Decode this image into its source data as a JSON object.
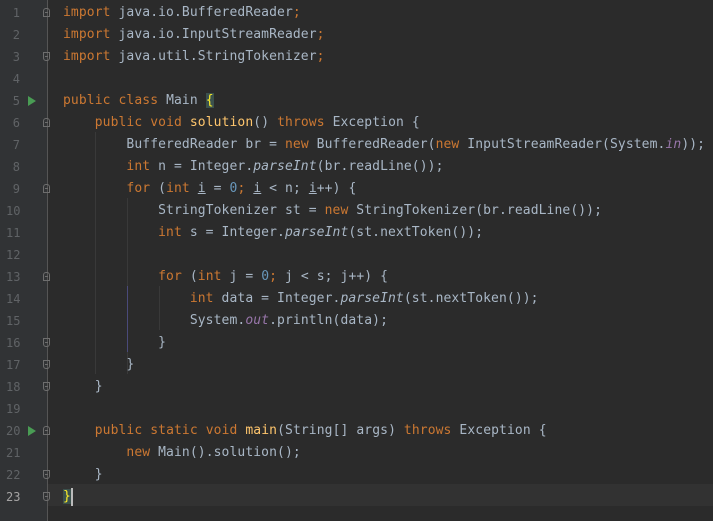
{
  "editor": {
    "lines": [
      {
        "n": "1"
      },
      {
        "n": "2"
      },
      {
        "n": "3"
      },
      {
        "n": "4"
      },
      {
        "n": "5"
      },
      {
        "n": "6"
      },
      {
        "n": "7"
      },
      {
        "n": "8"
      },
      {
        "n": "9"
      },
      {
        "n": "10"
      },
      {
        "n": "11"
      },
      {
        "n": "12"
      },
      {
        "n": "13"
      },
      {
        "n": "14"
      },
      {
        "n": "15"
      },
      {
        "n": "16"
      },
      {
        "n": "17"
      },
      {
        "n": "18"
      },
      {
        "n": "19"
      },
      {
        "n": "20"
      },
      {
        "n": "21"
      },
      {
        "n": "22"
      },
      {
        "n": "23"
      }
    ],
    "tokens": {
      "import": "import",
      "pkg_buffered": " java.io.BufferedReader",
      "pkg_isr": " java.io.InputStreamReader",
      "pkg_tok": " java.util.StringTokenizer",
      "semi": ";",
      "public": "public",
      "class": "class",
      "main_class": " Main ",
      "brace_open": "{",
      "brace_close": "}",
      "void": "void",
      "solution": "solution",
      "parens": "()",
      "throws": "throws",
      "exception": " Exception ",
      "br_decl": "BufferedReader br = ",
      "new": "new",
      "br_ctor": " BufferedReader(",
      "isr_ctor": " InputStreamReader(System.",
      "in": "in",
      "close_paren_2": "));",
      "int": "int",
      "n_decl": " n = Integer.",
      "parseInt": "parseInt",
      "br_readline": "(br.readLine());",
      "for": "for",
      "for_open": " (",
      "i_var": "i",
      "eq": " = ",
      "zero": "0",
      "i_cond_a": " ",
      "lt_n": " < n; ",
      "inc": "++) ",
      "st_decl": "StringTokenizer st = ",
      "st_ctor": " StringTokenizer(br.readLine());",
      "s_decl": " s = Integer.",
      "st_next": "(st.nextToken());",
      "j_var": "j",
      "lt_s": " < s; ",
      "data_decl": " data = Integer.",
      "sysout": "System.",
      "out": "out",
      "println": ".println(data);",
      "static": "static",
      "main_fn": "main",
      "main_args": "(String[] args) ",
      "new_main": " Main().solution();"
    }
  }
}
